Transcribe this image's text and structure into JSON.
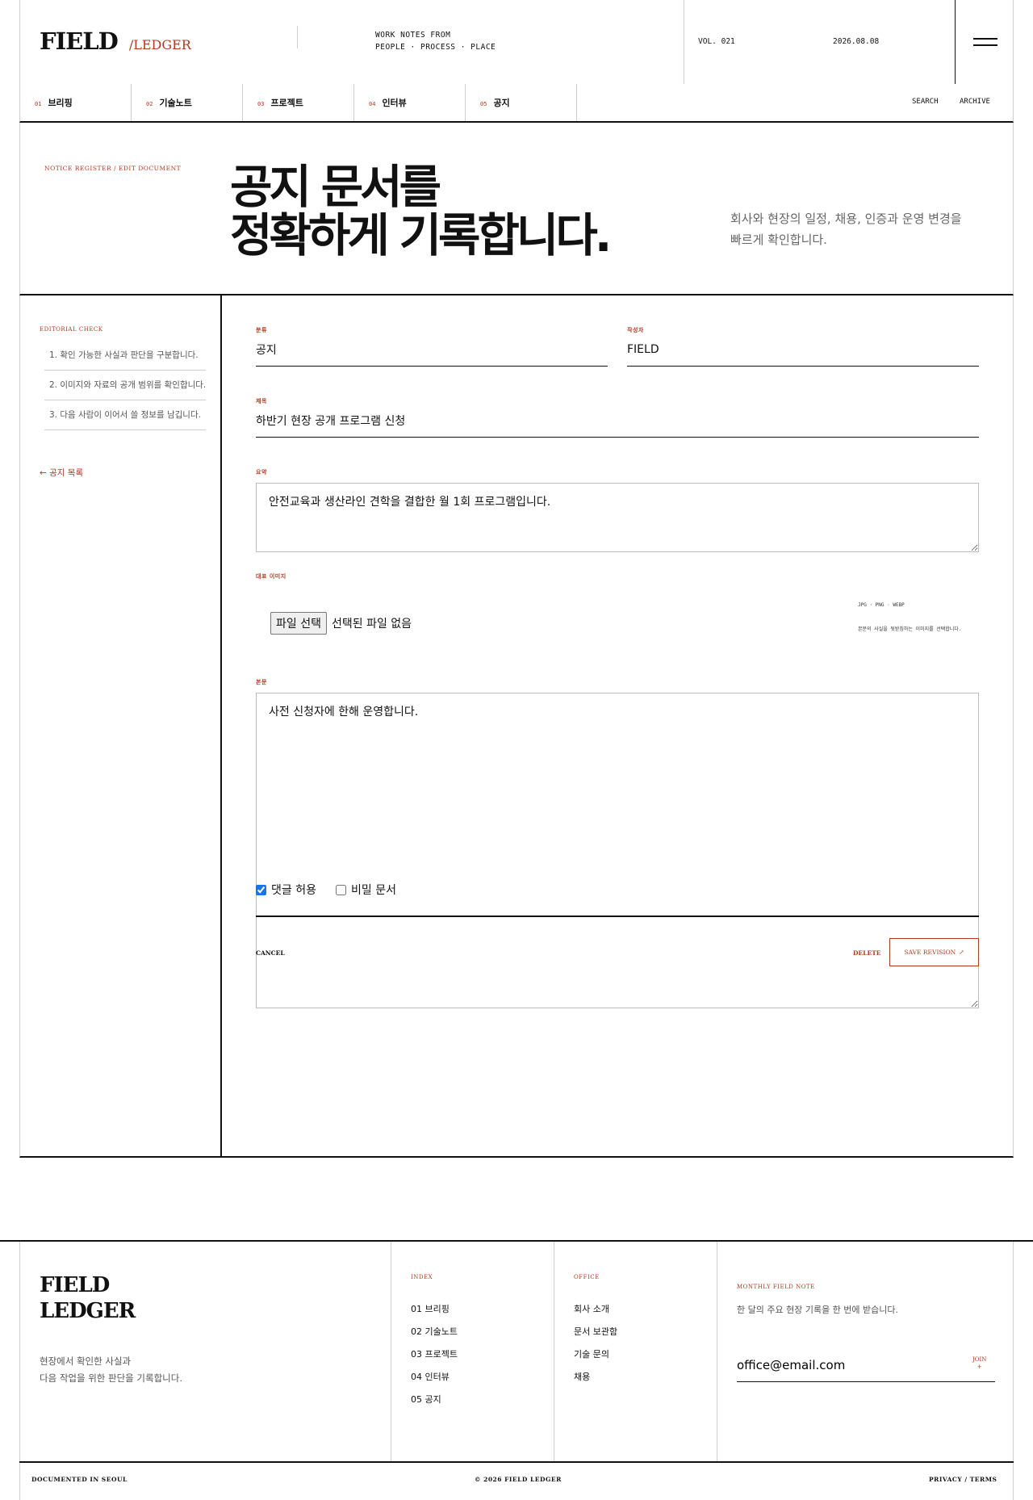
{
  "header": {
    "brand_main": "FIELD",
    "brand_sub": "/LEDGER",
    "tagline_line1": "WORK NOTES FROM",
    "tagline_line2": "PEOPLE · PROCESS · PLACE",
    "volume": "VOL. 021",
    "date": "2026.08.08",
    "menu_icon": "hamburger-menu-icon"
  },
  "nav": {
    "items": [
      {
        "num": "01",
        "label": "브리핑"
      },
      {
        "num": "02",
        "label": "기술노트"
      },
      {
        "num": "03",
        "label": "프로젝트"
      },
      {
        "num": "04",
        "label": "인터뷰"
      },
      {
        "num": "05",
        "label": "공지"
      }
    ],
    "search": "SEARCH",
    "archive": "ARCHIVE"
  },
  "hero": {
    "breadcrumb": "NOTICE REGISTER / EDIT DOCUMENT",
    "title_line1": "공지 문서를",
    "title_line2": "정확하게 기록합니다.",
    "desc_line1": "회사와 현장의 일정, 채용, 인증과 운영 변경을",
    "desc_line2": "빠르게 확인합니다."
  },
  "sidebar": {
    "label": "EDITORIAL CHECK",
    "checklist": [
      "1. 확인 가능한 사실과 판단을 구분합니다.",
      "2. 이미지와 자료의 공개 범위를 확인합니다.",
      "3. 다음 사람이 이어서 쓸 정보를 남깁니다."
    ],
    "back_link": "← 공지 목록"
  },
  "form": {
    "category_label": "분류",
    "category_value": "공지",
    "author_label": "작성자",
    "author_value": "FIELD",
    "title_label": "제목",
    "title_value": "하반기 현장 공개 프로그램 신청",
    "summary_label": "요약",
    "summary_value": "안전교육과 생산라인 견학을 결합한 월 1회 프로그램입니다.",
    "image_label": "대표 이미지",
    "file_button": "파일 선택",
    "file_status": "선택된 파일 없음",
    "file_formats": "JPG · PNG · WEBP",
    "file_hint": "본문의 사실을 뒷받침하는 이미지를 선택합니다.",
    "body_label": "본문",
    "body_value": "사전 신청자에 한해 운영합니다.",
    "allow_comments_label": "댓글 허용",
    "allow_comments_checked": true,
    "private_label": "비밀 문서",
    "private_checked": false,
    "cancel_label": "CANCEL",
    "delete_label": "DELETE",
    "save_label": "SAVE REVISION",
    "save_icon": "arrow-up-right-icon"
  },
  "footer": {
    "brand_line1": "FIELD",
    "brand_line2": "LEDGER",
    "desc_line1": "현장에서 확인한 사실과",
    "desc_line2": "다음 작업을 위한 판단을 기록합니다.",
    "index_title": "INDEX",
    "index_items": [
      "01 브리핑",
      "02 기술노트",
      "03 프로젝트",
      "04 인터뷰",
      "05 공지"
    ],
    "office_title": "OFFICE",
    "office_items": [
      "회사 소개",
      "문서 보관함",
      "기술 문의",
      "채용"
    ],
    "newsletter_title": "MONTHLY FIELD NOTE",
    "newsletter_desc": "한 달의 주요 현장 기록을 한 번에 받습니다.",
    "newsletter_email": "office@email.com",
    "join_label": "JOIN",
    "join_icon": "+",
    "bottom_left": "DOCUMENTED IN SEOUL",
    "bottom_center": "© 2026 FIELD LEDGER",
    "bottom_right": "PRIVACY / TERMS"
  },
  "colors": {
    "accent": "#b23a1e",
    "ink": "#111111",
    "rule": "#cfcfcf"
  }
}
